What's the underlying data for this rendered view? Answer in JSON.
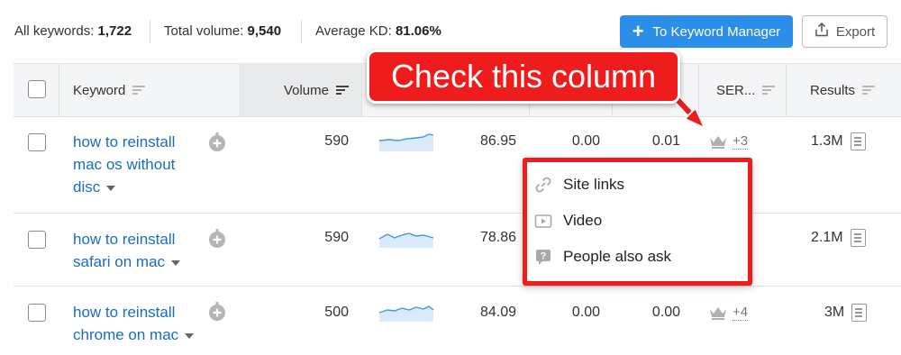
{
  "stats": {
    "all_keywords_label": "All keywords:",
    "all_keywords_value": "1,722",
    "total_volume_label": "Total volume:",
    "total_volume_value": "9,540",
    "average_kd_label": "Average KD:",
    "average_kd_value": "81.06%"
  },
  "toolbar": {
    "keyword_manager_label": "To Keyword Manager",
    "export_label": "Export"
  },
  "columns": {
    "keyword": "Keyword",
    "volume": "Volume",
    "serp": "SER...",
    "results": "Results"
  },
  "rows": [
    {
      "keyword": "how to reinstall mac os without disc",
      "volume": "590",
      "kd": "86.95",
      "cpc": "0.00",
      "com": "0.01",
      "serp_more": "+3",
      "results": "1.3M"
    },
    {
      "keyword": "how to reinstall safari on mac",
      "volume": "590",
      "kd": "78.86",
      "cpc": "",
      "com": "",
      "serp_more": "",
      "results": "2.1M"
    },
    {
      "keyword": "how to reinstall chrome on mac",
      "volume": "500",
      "kd": "84.09",
      "cpc": "0.00",
      "com": "0.00",
      "serp_more": "+4",
      "results": "3M"
    }
  ],
  "callout": {
    "text": "Check this column"
  },
  "serp_dropdown": {
    "items": [
      "Site links",
      "Video",
      "People also ask"
    ]
  },
  "colors": {
    "accent_blue": "#2b8ee8",
    "link_blue": "#1a6cc4",
    "annotation_red": "#ee1c1c"
  }
}
